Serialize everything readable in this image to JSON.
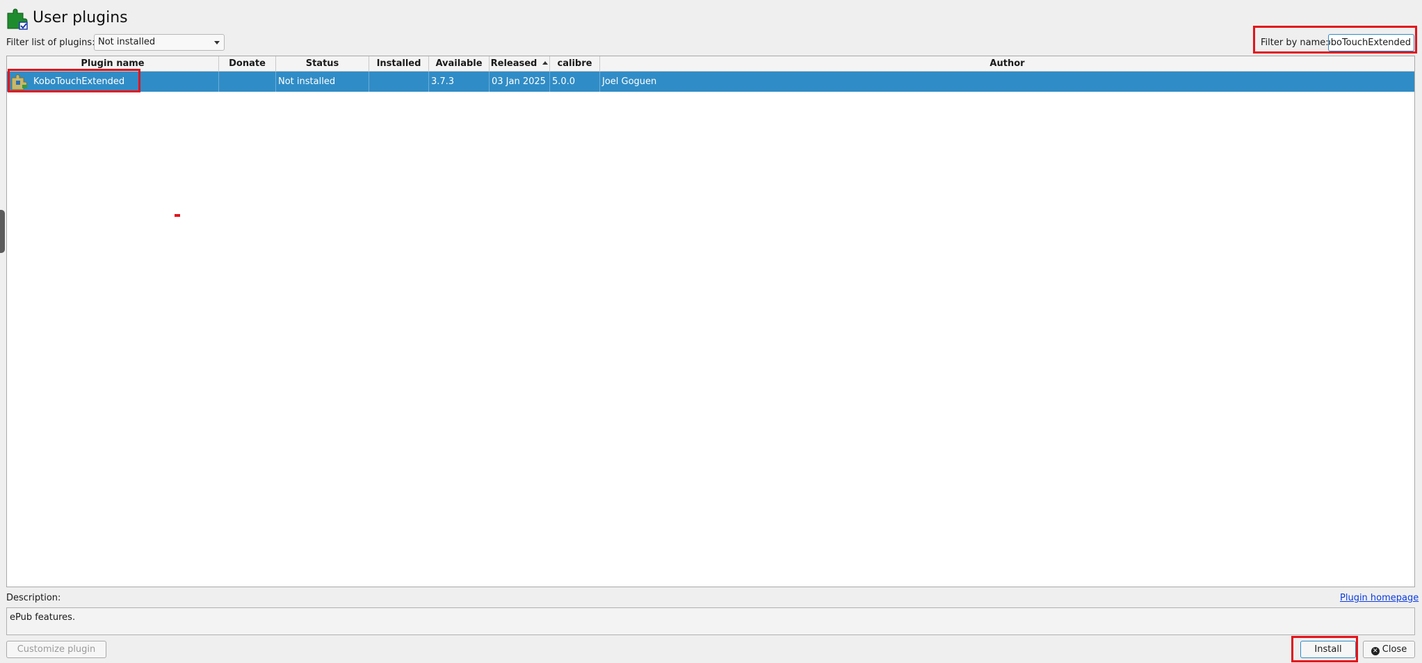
{
  "window": {
    "title": "User plugins"
  },
  "filter": {
    "label": "Filter list of plugins:",
    "selected": "Not installed"
  },
  "filter_by_name": {
    "label": "Filter by name:",
    "value": "KoboTouchExtended"
  },
  "table": {
    "columns": [
      "Plugin name",
      "Donate",
      "Status",
      "Installed",
      "Available",
      "Released",
      "calibre",
      "Author"
    ],
    "sorted_by": "Released",
    "rows": [
      {
        "plugin_name": "KoboTouchExtended",
        "donate": "",
        "status": "Not installed",
        "installed": "",
        "available": "3.7.3",
        "released": "03 Jan 2025",
        "calibre": "5.0.0",
        "author": "Joel Goguen",
        "selected": true
      }
    ]
  },
  "description": {
    "label": "Description:",
    "text": "ePub features.",
    "homepage_link": "Plugin homepage"
  },
  "buttons": {
    "customize": "Customize plugin",
    "install": "Install",
    "close": "Close"
  },
  "colors": {
    "selection": "#308cc6",
    "highlight_box": "#e3131b",
    "link": "#0a3be0"
  }
}
